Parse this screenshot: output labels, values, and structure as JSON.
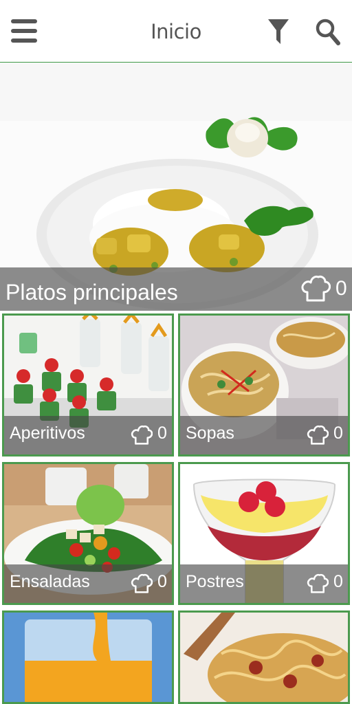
{
  "header": {
    "title": "Inicio",
    "menu_icon": "hamburger-menu-icon",
    "filter_icon": "funnel-filter-icon",
    "search_icon": "magnifier-search-icon"
  },
  "colors": {
    "accent_green": "#4b9a4e",
    "overlay": "rgba(70,70,70,0.62)",
    "icon_gray": "#555555"
  },
  "categories": [
    {
      "label": "Platos principales",
      "count": "0",
      "icon": "chef-hat-icon"
    },
    {
      "label": "Aperitivos",
      "count": "0",
      "icon": "chef-hat-icon"
    },
    {
      "label": "Sopas",
      "count": "0",
      "icon": "chef-hat-icon"
    },
    {
      "label": "Ensaladas",
      "count": "0",
      "icon": "chef-hat-icon"
    },
    {
      "label": "Postres",
      "count": "0",
      "icon": "chef-hat-icon"
    },
    {
      "label": "",
      "count": "",
      "icon": ""
    },
    {
      "label": "",
      "count": "",
      "icon": ""
    }
  ]
}
